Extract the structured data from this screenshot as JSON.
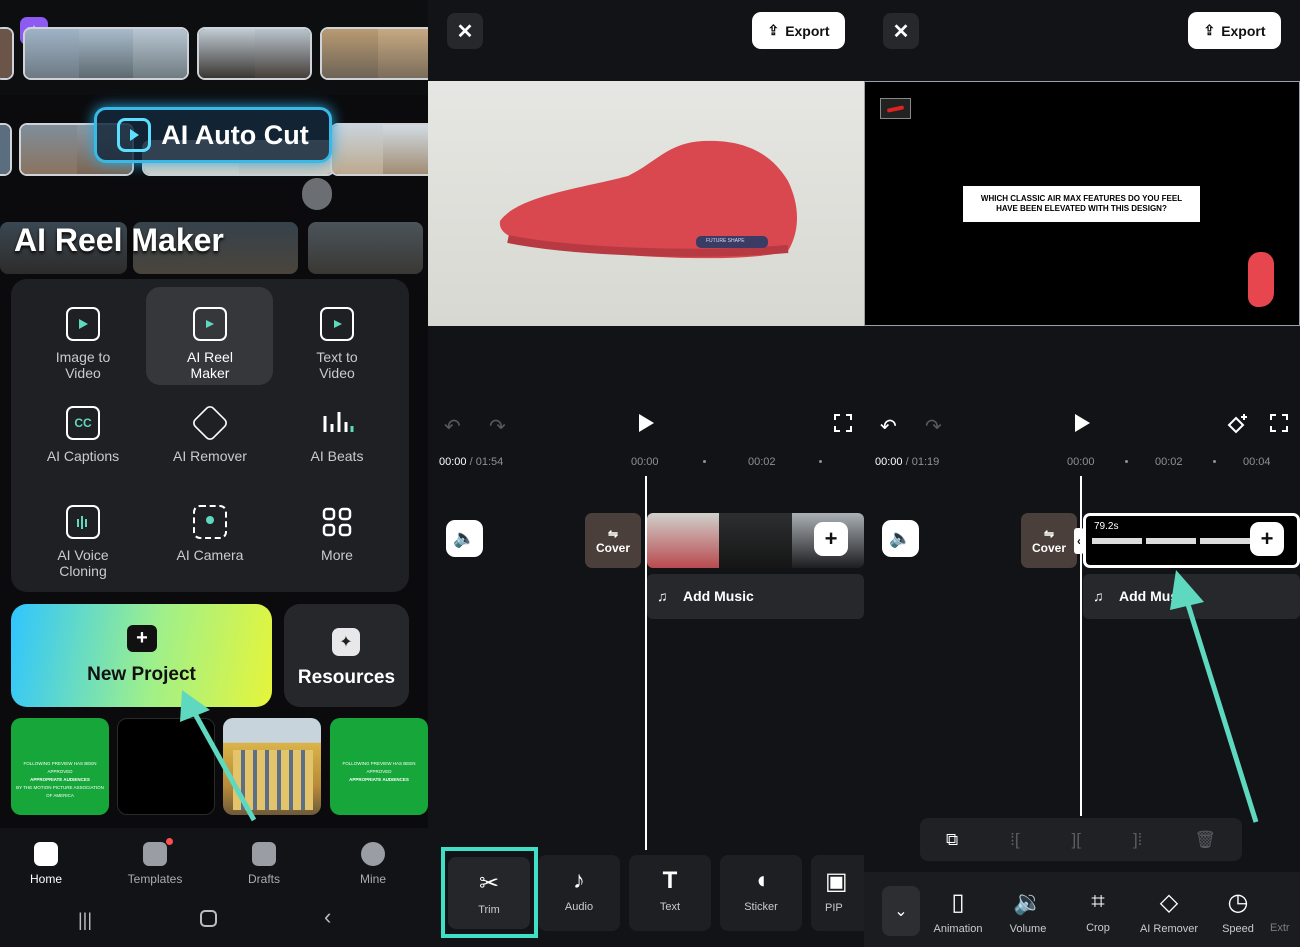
{
  "panel_home": {
    "banner_ai_auto_cut": "AI Auto Cut",
    "banner_ai_reel_maker": "AI Reel Maker",
    "tools": [
      {
        "label_line1": "Image to",
        "label_line2": "Video",
        "icon": "image-to-video-icon"
      },
      {
        "label_line1": "AI Reel",
        "label_line2": "Maker",
        "icon": "ai-reel-maker-icon"
      },
      {
        "label_line1": "Text to",
        "label_line2": "Video",
        "icon": "text-to-video-icon"
      },
      {
        "label_line1": "AI Captions",
        "label_line2": "",
        "icon": "cc-icon"
      },
      {
        "label_line1": "AI Remover",
        "label_line2": "",
        "icon": "eraser-icon"
      },
      {
        "label_line1": "AI Beats",
        "label_line2": "",
        "icon": "beats-icon"
      },
      {
        "label_line1": "AI Voice",
        "label_line2": "Cloning",
        "icon": "voice-icon"
      },
      {
        "label_line1": "AI Camera",
        "label_line2": "",
        "icon": "camera-icon"
      },
      {
        "label_line1": "More",
        "label_line2": "",
        "icon": "grid-icon"
      }
    ],
    "new_project": "New Project",
    "resources": "Resources",
    "draft_text_line1": "FOLLOWING PREVIEW HAS BEEN APPROVED",
    "draft_text_line2": "APPROPRIATE AUDIENCES",
    "draft_text_line3": "BY THE MOTION PICTURE ASSOCIATION OF AMERICA",
    "nav": [
      {
        "label": "Home",
        "icon": "home-icon"
      },
      {
        "label": "Templates",
        "icon": "templates-icon"
      },
      {
        "label": "Drafts",
        "icon": "drafts-icon"
      },
      {
        "label": "Mine",
        "icon": "profile-icon"
      }
    ]
  },
  "panel_editor1": {
    "export": "Export",
    "current_time": "00:00",
    "total_time": "/ 01:54",
    "ticks": [
      "00:00",
      "00:02"
    ],
    "cover": "Cover",
    "add_music": "Add Music",
    "toolbar": [
      "Trim",
      "Audio",
      "Text",
      "Sticker",
      "PIP"
    ],
    "shoe_caption": "FUTURE SHAPE"
  },
  "panel_editor2": {
    "export": "Export",
    "current_time": "00:00",
    "total_time": "/ 01:19",
    "ticks": [
      "00:00",
      "00:02",
      "00:04"
    ],
    "cover": "Cover",
    "clip_duration": "79.2s",
    "add_music": "Add Musi",
    "question_line1": "WHICH CLASSIC AIR MAX FEATURES DO YOU FEEL",
    "question_line2": "HAVE BEEN ELEVATED WITH THIS DESIGN?",
    "toolbar": [
      "Animation",
      "Volume",
      "Crop",
      "AI Remover",
      "Speed",
      "Extr"
    ]
  },
  "colors": {
    "accent_teal": "#5fd8c0",
    "highlight_box": "#3fe0c5",
    "new_project_gradient": [
      "#2ec5ff",
      "#9ff08a",
      "#e6f53a"
    ]
  }
}
